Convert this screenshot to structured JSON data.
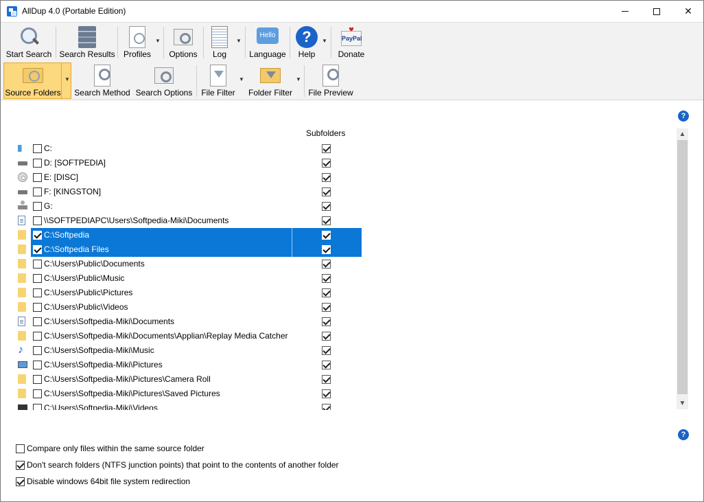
{
  "window": {
    "title": "AllDup 4.0 (Portable Edition)"
  },
  "toolbar_main": [
    {
      "id": "start-search",
      "label": "Start Search",
      "icon": "magnifier-icon"
    },
    {
      "id": "search-results",
      "label": "Search Results",
      "icon": "server-icon"
    },
    {
      "id": "profiles",
      "label": "Profiles",
      "icon": "profile-doc-icon"
    },
    {
      "id": "options",
      "label": "Options",
      "icon": "gear-icon"
    },
    {
      "id": "log",
      "label": "Log",
      "icon": "log-icon"
    },
    {
      "id": "language",
      "label": "Language",
      "icon": "hello-icon",
      "icon_text": "Hello"
    },
    {
      "id": "help",
      "label": "Help",
      "icon": "help-icon",
      "icon_text": "?"
    },
    {
      "id": "donate",
      "label": "Donate",
      "icon": "paypal-icon",
      "icon_text": "PayPal"
    }
  ],
  "toolbar_sub": [
    {
      "id": "source-folders",
      "label": "Source Folders",
      "icon": "folder-icon",
      "active": true
    },
    {
      "id": "search-method",
      "label": "Search Method",
      "icon": "search-method-icon"
    },
    {
      "id": "search-options",
      "label": "Search Options",
      "icon": "search-options-icon"
    },
    {
      "id": "file-filter",
      "label": "File Filter",
      "icon": "file-filter-icon"
    },
    {
      "id": "folder-filter",
      "label": "Folder Filter",
      "icon": "folder-filter-icon"
    },
    {
      "id": "file-preview",
      "label": "File Preview",
      "icon": "file-preview-icon"
    }
  ],
  "list": {
    "subfolders_header": "Subfolders",
    "rows": [
      {
        "path": "C:",
        "icon": "system-drive-icon",
        "checked": false,
        "subfolders": true,
        "selected": false
      },
      {
        "path": "D: [SOFTPEDIA]",
        "icon": "drive-icon",
        "checked": false,
        "subfolders": true,
        "selected": false
      },
      {
        "path": "E: [DISC]",
        "icon": "disc-icon",
        "checked": false,
        "subfolders": true,
        "selected": false
      },
      {
        "path": "F: [KINGSTON]",
        "icon": "drive-icon",
        "checked": false,
        "subfolders": true,
        "selected": false
      },
      {
        "path": "G:",
        "icon": "network-drive-icon",
        "checked": false,
        "subfolders": true,
        "selected": false
      },
      {
        "path": "\\\\SOFTPEDIAPC\\Users\\Softpedia-Miki\\Documents",
        "icon": "document-icon",
        "checked": false,
        "subfolders": true,
        "selected": false
      },
      {
        "path": "C:\\Softpedia",
        "icon": "folder-icon",
        "checked": true,
        "subfolders": true,
        "selected": true
      },
      {
        "path": "C:\\Softpedia Files",
        "icon": "folder-icon",
        "checked": true,
        "subfolders": true,
        "selected": true
      },
      {
        "path": "C:\\Users\\Public\\Documents",
        "icon": "folder-icon",
        "checked": false,
        "subfolders": true,
        "selected": false
      },
      {
        "path": "C:\\Users\\Public\\Music",
        "icon": "folder-icon",
        "checked": false,
        "subfolders": true,
        "selected": false
      },
      {
        "path": "C:\\Users\\Public\\Pictures",
        "icon": "folder-icon",
        "checked": false,
        "subfolders": true,
        "selected": false
      },
      {
        "path": "C:\\Users\\Public\\Videos",
        "icon": "folder-icon",
        "checked": false,
        "subfolders": true,
        "selected": false
      },
      {
        "path": "C:\\Users\\Softpedia-Miki\\Documents",
        "icon": "document-icon",
        "checked": false,
        "subfolders": true,
        "selected": false
      },
      {
        "path": "C:\\Users\\Softpedia-Miki\\Documents\\Applian\\Replay Media Catcher",
        "icon": "folder-icon",
        "checked": false,
        "subfolders": true,
        "selected": false
      },
      {
        "path": "C:\\Users\\Softpedia-Miki\\Music",
        "icon": "music-icon",
        "checked": false,
        "subfolders": true,
        "selected": false
      },
      {
        "path": "C:\\Users\\Softpedia-Miki\\Pictures",
        "icon": "pictures-icon",
        "checked": false,
        "subfolders": true,
        "selected": false
      },
      {
        "path": "C:\\Users\\Softpedia-Miki\\Pictures\\Camera Roll",
        "icon": "folder-icon",
        "checked": false,
        "subfolders": true,
        "selected": false
      },
      {
        "path": "C:\\Users\\Softpedia-Miki\\Pictures\\Saved Pictures",
        "icon": "folder-icon",
        "checked": false,
        "subfolders": true,
        "selected": false
      },
      {
        "path": "C:\\Users\\Softpedia-Miki\\Videos",
        "icon": "video-icon",
        "checked": false,
        "subfolders": true,
        "selected": false
      }
    ]
  },
  "options": [
    {
      "label": "Compare only files within the same source folder",
      "checked": false
    },
    {
      "label": "Don't search folders (NTFS junction points) that point to the contents of another folder",
      "checked": true
    },
    {
      "label": "Disable windows 64bit file system redirection",
      "checked": true
    }
  ],
  "help_icon_text": "?"
}
